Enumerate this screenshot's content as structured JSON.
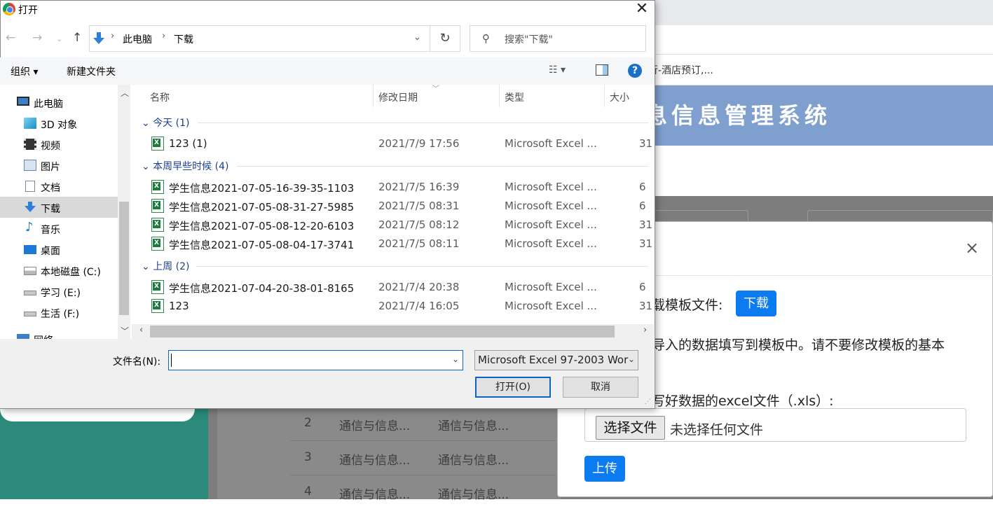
{
  "background": {
    "bookmark": "行-酒店预订,...",
    "banner_title": "息信息管理系统",
    "table_rows": [
      {
        "num": "2",
        "c1": "通信与信息...",
        "c2": "通信与信息..."
      },
      {
        "num": "3",
        "c1": "通信与信息...",
        "c2": "通信与信息..."
      },
      {
        "num": "4",
        "c1": "通信与信息...",
        "c2": "通信与信息..."
      }
    ]
  },
  "modal": {
    "close": "×",
    "template_label": "载模板文件:",
    "download_btn": "下载",
    "instruction": "导入的数据填写到模板中。请不要修改模板的基本",
    "select_label": "写好数据的excel文件（.xls）:",
    "choose_file_btn": "选择文件",
    "no_file_text": "未选择任何文件",
    "upload_btn": "上传"
  },
  "dialog": {
    "title": "打开",
    "close": "✕",
    "breadcrumb": [
      "此电脑",
      "下载"
    ],
    "search_placeholder": "搜索\"下载\"",
    "toolbar": {
      "organize": "组织 ▾",
      "new_folder": "新建文件夹",
      "view": "☷ ▾"
    },
    "sidebar": [
      {
        "label": "此电脑",
        "icon": "computer-icon"
      },
      {
        "label": "3D 对象",
        "icon": "cube-icon"
      },
      {
        "label": "视频",
        "icon": "video-icon"
      },
      {
        "label": "图片",
        "icon": "picture-icon"
      },
      {
        "label": "文档",
        "icon": "document-icon"
      },
      {
        "label": "下载",
        "icon": "download-icon",
        "selected": true
      },
      {
        "label": "音乐",
        "icon": "music-icon"
      },
      {
        "label": "桌面",
        "icon": "desktop-icon"
      },
      {
        "label": "本地磁盘 (C:)",
        "icon": "disk-icon"
      },
      {
        "label": "学习 (E:)",
        "icon": "drive-icon"
      },
      {
        "label": "生活 (F:)",
        "icon": "drive-icon"
      },
      {
        "label": "网络",
        "icon": "network-icon"
      }
    ],
    "columns": {
      "name": "名称",
      "date": "修改日期",
      "type": "类型",
      "size": "大小"
    },
    "groups": [
      {
        "label": "今天 (1)"
      },
      {
        "label": "本周早些时候 (4)"
      },
      {
        "label": "上周 (2)"
      }
    ],
    "files": [
      {
        "name": "123 (1)",
        "date": "2021/7/9 17:56",
        "type": "Microsoft Excel ...",
        "size": "31"
      },
      {
        "name": "学生信息2021-07-05-16-39-35-1103",
        "date": "2021/7/5 16:39",
        "type": "Microsoft Excel ...",
        "size": "6"
      },
      {
        "name": "学生信息2021-07-05-08-31-27-5985",
        "date": "2021/7/5 08:31",
        "type": "Microsoft Excel ...",
        "size": "6"
      },
      {
        "name": "学生信息2021-07-05-08-12-20-6103",
        "date": "2021/7/5 08:12",
        "type": "Microsoft Excel ...",
        "size": "31"
      },
      {
        "name": "学生信息2021-07-05-08-04-17-3741",
        "date": "2021/7/5 08:11",
        "type": "Microsoft Excel ...",
        "size": "31"
      },
      {
        "name": "学生信息2021-07-04-20-38-01-8165",
        "date": "2021/7/4 20:38",
        "type": "Microsoft Excel ...",
        "size": "6"
      },
      {
        "name": "123",
        "date": "2021/7/4 16:05",
        "type": "Microsoft Excel ...",
        "size": "31"
      }
    ],
    "filename_label": "文件名(N):",
    "filename_value": "",
    "filetype_value": "Microsoft Excel 97-2003 Wor",
    "open_btn": "打开(O)",
    "cancel_btn": "取消",
    "help": "?"
  },
  "colors": {
    "accent": "#0d7bf0",
    "dialog_focus": "#0a64c8",
    "banner": "#7f9fcf"
  }
}
